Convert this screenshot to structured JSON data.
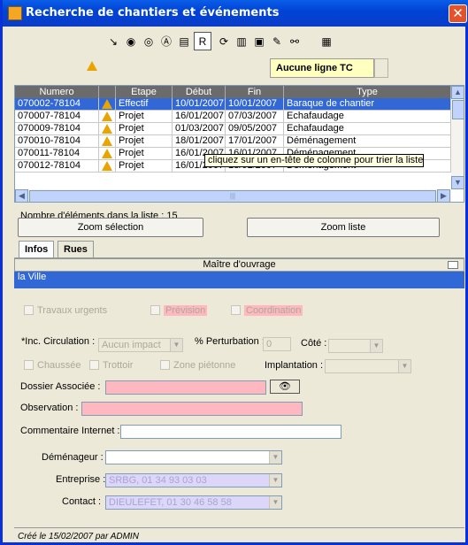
{
  "window": {
    "title": "Recherche de chantiers et événements",
    "close_label": "✕"
  },
  "toolbar": {
    "buttons": [
      {
        "name": "new-event-icon",
        "glyph": "↘"
      },
      {
        "name": "globe-icon",
        "glyph": "◉"
      },
      {
        "name": "target-icon",
        "glyph": "◎"
      },
      {
        "name": "stamp-icon",
        "glyph": "Ⓐ"
      },
      {
        "name": "document-icon",
        "glyph": "▤"
      },
      {
        "name": "report-r-icon",
        "glyph": "R"
      },
      {
        "name": "refresh-icon",
        "glyph": "⟳"
      },
      {
        "name": "printer-icon",
        "glyph": "▥"
      },
      {
        "name": "export-red-icon",
        "glyph": "▣"
      },
      {
        "name": "edit-pencil-icon",
        "glyph": "✎"
      },
      {
        "name": "binoculars-icon",
        "glyph": "⚯"
      },
      {
        "name": "map-grid-icon",
        "glyph": "▦"
      }
    ]
  },
  "tc_box": {
    "value": "Aucune ligne TC"
  },
  "grid": {
    "headers": [
      "Numero",
      "",
      "Etape",
      "Début",
      "Fin",
      "Type"
    ],
    "rows": [
      {
        "numero": "070002-78104",
        "etape": "Effectif",
        "debut": "10/01/2007",
        "fin": "10/01/2007",
        "type": "Baraque de chantier"
      },
      {
        "numero": "070007-78104",
        "etape": "Projet",
        "debut": "16/01/2007",
        "fin": "07/03/2007",
        "type": "Echafaudage"
      },
      {
        "numero": "070009-78104",
        "etape": "Projet",
        "debut": "01/03/2007",
        "fin": "09/05/2007",
        "type": "Echafaudage"
      },
      {
        "numero": "070010-78104",
        "etape": "Projet",
        "debut": "18/01/2007",
        "fin": "17/01/2007",
        "type": "Déménagement"
      },
      {
        "numero": "070011-78104",
        "etape": "Projet",
        "debut": "16/01/2007",
        "fin": "16/01/2007",
        "type": "Déménagement"
      },
      {
        "numero": "070012-78104",
        "etape": "Projet",
        "debut": "16/01/2007",
        "fin": "18/01/2007",
        "type": "Déménagement"
      }
    ],
    "tooltip": "cliquez sur un en-tête de colonne pour trier la liste"
  },
  "count_label": "Nombre d'éléments dans la liste : 15",
  "buttons": {
    "zoom_selection": "Zoom sélection",
    "zoom_liste": "Zoom liste"
  },
  "tabs": [
    "Infos",
    "Rues"
  ],
  "maitre": {
    "header": "Maître d'ouvrage",
    "value": "la Ville"
  },
  "checks": {
    "travaux_urgents": "Travaux urgents",
    "prevision": "Prévision",
    "coordination": "Coordination",
    "chaussee": "Chaussée",
    "trottoir": "Trottoir",
    "zone_pietonne": "Zone piétonne"
  },
  "form": {
    "inc_circulation_label": "*Inc. Circulation :",
    "inc_circulation_value": "Aucun impact",
    "perturbation_label": "% Perturbation :",
    "perturbation_value": "0",
    "cote_label": "Côté :",
    "implantation_label": "Implantation :",
    "dossier_label": "Dossier Associée :",
    "observation_label": "Observation :",
    "commentaire_label": "Commentaire Internet :",
    "demenageur_label": "Déménageur :",
    "entreprise_label": "Entreprise :",
    "entreprise_value": "SRBG, 01 34 93 03 03",
    "contact_label": "Contact :",
    "contact_value": "DIEULEFET, 01 30 46 58 58"
  },
  "footer": "Créé le 15/02/2007 par ADMIN"
}
